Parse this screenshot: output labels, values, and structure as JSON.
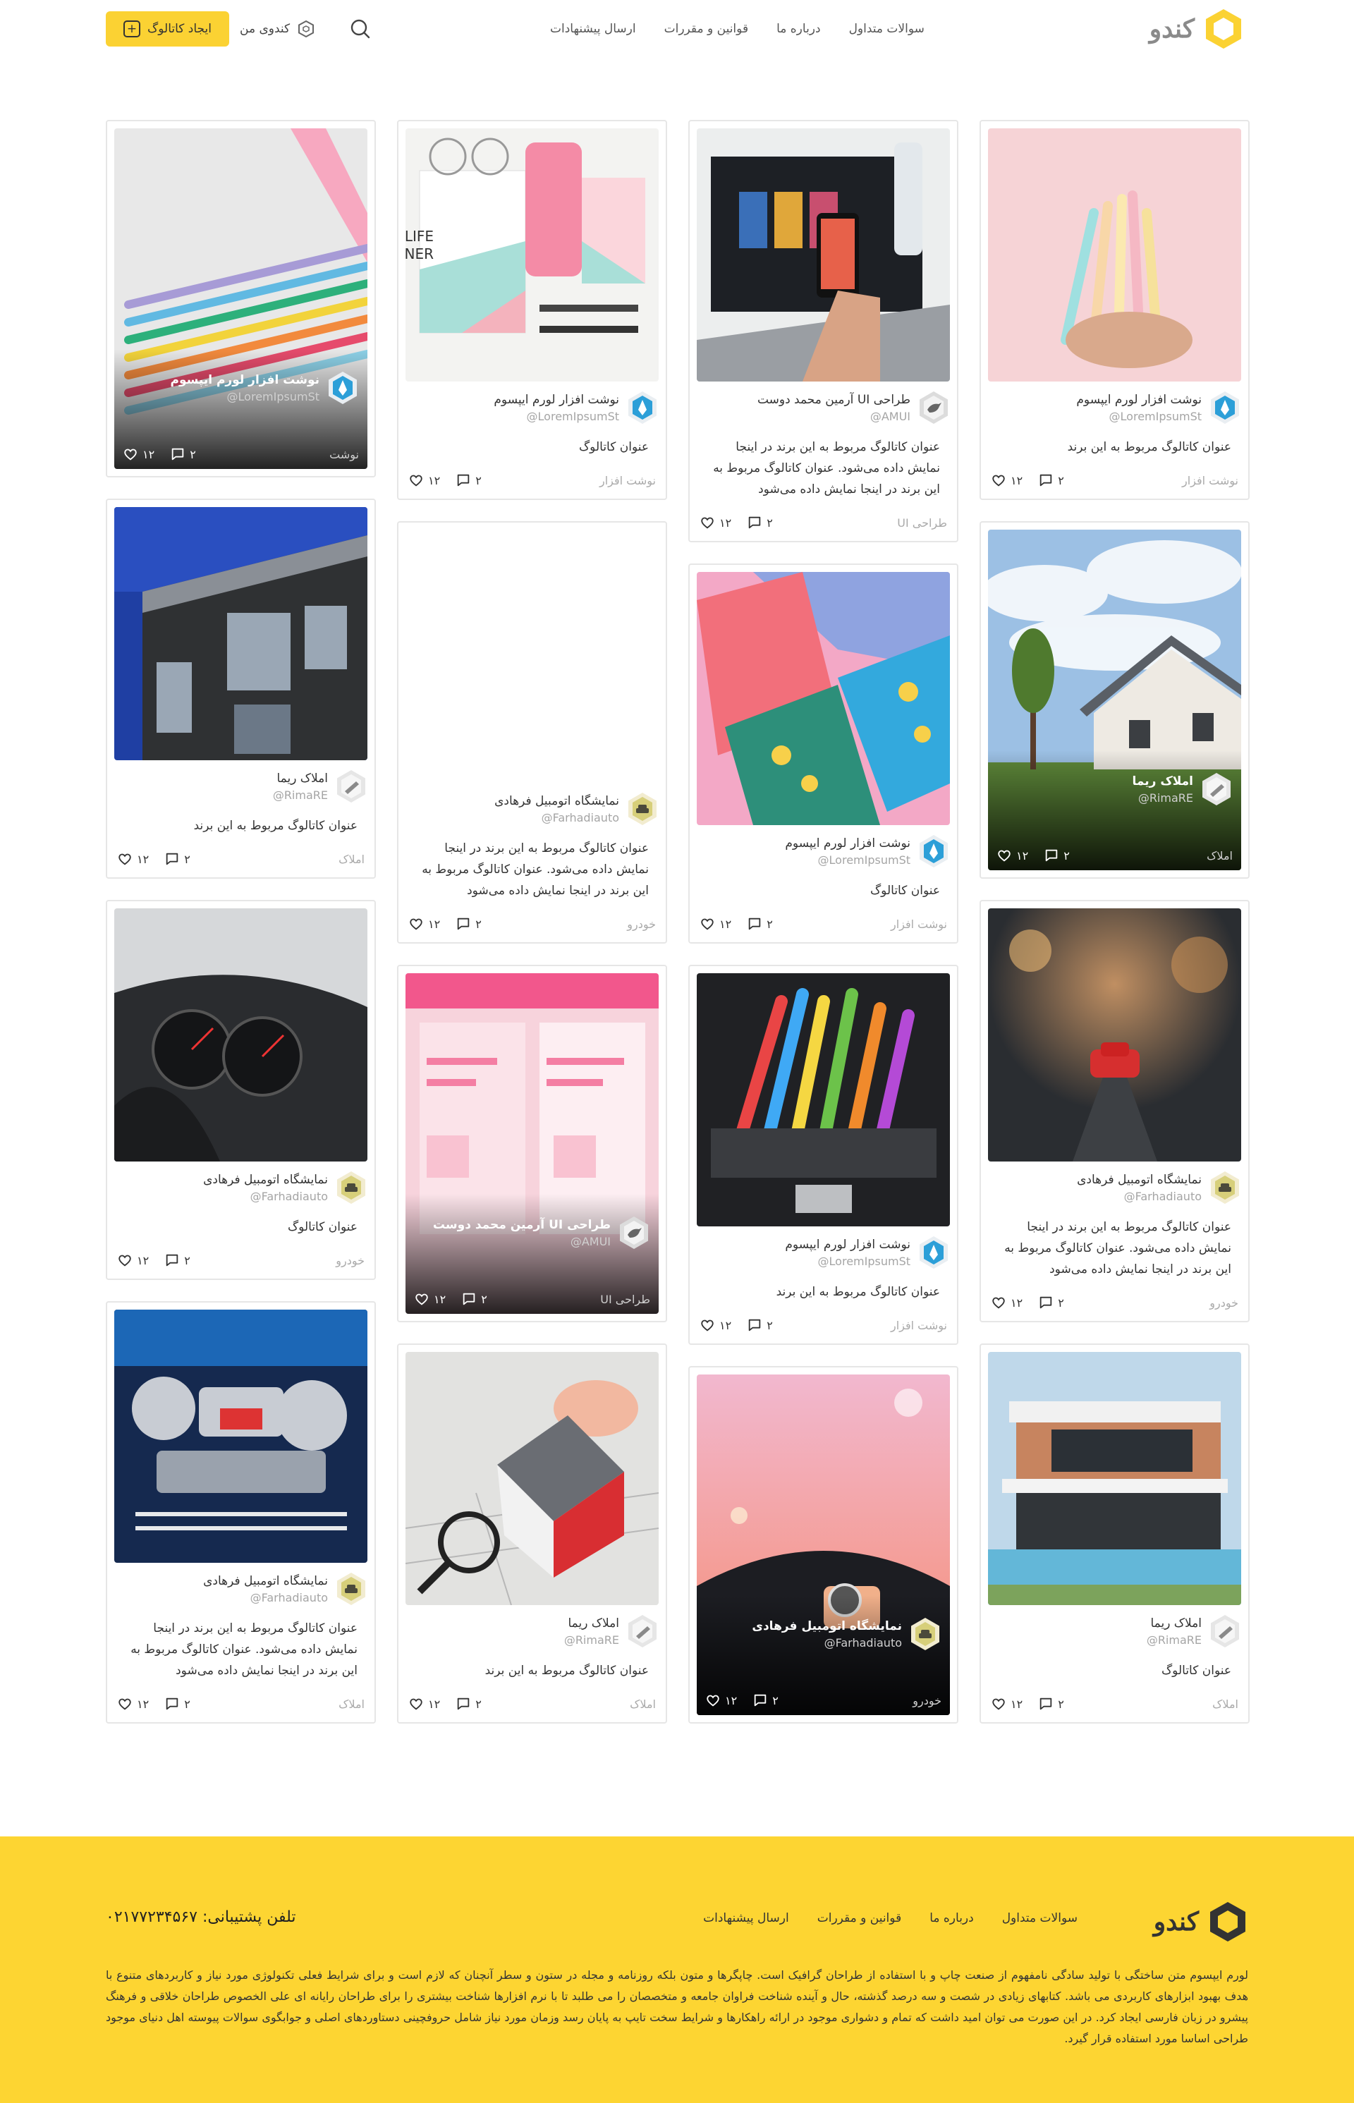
{
  "header": {
    "logo_text": "کندو",
    "nav": [
      "سوالات متداول",
      "درباره ما",
      "قوانین و مقررات",
      "ارسال پیشنهادات"
    ],
    "my_kandoo": "کندوی من",
    "create_catalog": "ایجاد کاتالوگ"
  },
  "columns": [
    [
      {
        "style": "normal",
        "image": "pens",
        "brand": "نوشت افزار لورم ایپسوم",
        "handle": "@LoremIpsumSt",
        "brand_icon": "pen-nib",
        "title": "عنوان کاتالوگ مربوط به این برند",
        "category": "نوشت افزار",
        "likes": "۱۲",
        "comments": "۲"
      },
      {
        "style": "overlay",
        "image": "house",
        "brand": "املاک ریما",
        "handle": "@RimaRE",
        "brand_icon": "building",
        "category": "املاک",
        "likes": "۱۲",
        "comments": "۲"
      },
      {
        "style": "normal",
        "image": "toy-car",
        "brand": "نمایشگاه اتومبیل فرهادی",
        "handle": "@Farhadiauto",
        "brand_icon": "car",
        "title": "عنوان کاتالوگ مربوط به این برند در اینجا نمایش داده می‌شود. عنوان کاتالوگ مربوط به این برند در اینجا نمایش داده می‌شود",
        "category": "خودرو",
        "likes": "۱۲",
        "comments": "۲"
      },
      {
        "style": "normal",
        "image": "modern-house",
        "brand": "املاک ریما",
        "handle": "@RimaRE",
        "brand_icon": "building",
        "title": "عنوان کاتالوگ",
        "category": "املاک",
        "likes": "۱۲",
        "comments": "۲"
      }
    ],
    [
      {
        "style": "normal",
        "image": "laptop",
        "brand": "طراحی UI آرمین محمد دوست",
        "handle": "@AMUI",
        "brand_icon": "bird",
        "title": "عنوان کاتالوگ مربوط به این برند در اینجا نمایش داده می‌شود. عنوان کاتالوگ مربوط به این برند در اینجا نمایش داده می‌شود",
        "category": "طراحی UI",
        "likes": "۱۲",
        "comments": "۲"
      },
      {
        "style": "normal",
        "image": "patterns",
        "brand": "نوشت افزار لورم ایپسوم",
        "handle": "@LoremIpsumSt",
        "brand_icon": "pen-nib",
        "title": "عنوان کاتالوگ",
        "category": "نوشت افزار",
        "likes": "۱۲",
        "comments": "۲"
      },
      {
        "style": "normal",
        "image": "markers",
        "brand": "نوشت افزار لورم ایپسوم",
        "handle": "@LoremIpsumSt",
        "brand_icon": "pen-nib",
        "title": "عنوان کاتالوگ مربوط به این برند",
        "category": "نوشت افزار",
        "likes": "۱۲",
        "comments": "۲"
      },
      {
        "style": "overlay-tall",
        "image": "driving",
        "brand": "نمایشگاه اتومبیل فرهادی",
        "handle": "@Farhadiauto",
        "brand_icon": "car",
        "category": "خودرو",
        "likes": "۱۲",
        "comments": "۲"
      }
    ],
    [
      {
        "style": "normal",
        "image": "planner",
        "brand": "نوشت افزار لورم ایپسوم",
        "handle": "@LoremIpsumSt",
        "brand_icon": "pen-nib",
        "title": "عنوان کاتالوگ",
        "category": "نوشت افزار",
        "likes": "۱۲",
        "comments": "۲"
      },
      {
        "style": "normal",
        "image": "blue-car",
        "brand": "نمایشگاه اتومبیل فرهادی",
        "handle": "@Farhadiauto",
        "brand_icon": "car",
        "title": "عنوان کاتالوگ مربوط به این برند در اینجا نمایش داده می‌شود. عنوان کاتالوگ مربوط به این برند در اینجا نمایش داده می‌شود",
        "category": "خودرو",
        "likes": "۱۲",
        "comments": "۲"
      },
      {
        "style": "overlay-tall",
        "image": "pink-ui",
        "brand": "طراحی UI آرمین محمد دوست",
        "handle": "@AMUI",
        "brand_icon": "bird",
        "category": "طراحی UI",
        "likes": "۱۲",
        "comments": "۲"
      },
      {
        "style": "normal",
        "image": "house-model",
        "brand": "املاک ریما",
        "handle": "@RimaRE",
        "brand_icon": "building",
        "title": "عنوان کاتالوگ مربوط به این برند",
        "category": "املاک",
        "likes": "۱۲",
        "comments": "۲"
      }
    ],
    [
      {
        "style": "overlay-tall",
        "image": "color-pencils",
        "brand": "نوشت افزار لورم ایپسوم",
        "handle": "@LoremIpsumSt",
        "brand_icon": "pen-nib",
        "category": "نوشت",
        "likes": "۱۲",
        "comments": "۲"
      },
      {
        "style": "normal",
        "image": "building-blue",
        "brand": "املاک ریما",
        "handle": "@RimaRE",
        "brand_icon": "building",
        "title": "عنوان کاتالوگ مربوط به این برند",
        "category": "املاک",
        "likes": "۱۲",
        "comments": "۲"
      },
      {
        "style": "normal",
        "image": "dashboard",
        "brand": "نمایشگاه اتومبیل فرهادی",
        "handle": "@Farhadiauto",
        "brand_icon": "car",
        "title": "عنوان کاتالوگ",
        "category": "خودرو",
        "likes": "۱۲",
        "comments": "۲"
      },
      {
        "style": "normal",
        "image": "engine",
        "brand": "نمایشگاه اتومبیل فرهادی",
        "handle": "@Farhadiauto",
        "brand_icon": "car",
        "title": "عنوان کاتالوگ مربوط به این برند در اینجا نمایش داده می‌شود. عنوان کاتالوگ مربوط به این برند در اینجا نمایش داده می‌شود",
        "category": "املاک",
        "likes": "۱۲",
        "comments": "۲"
      }
    ]
  ],
  "footer": {
    "logo_text": "کندو",
    "nav": [
      "سوالات متداول",
      "درباره ما",
      "قوانین و مقررات",
      "ارسال پیشنهادات"
    ],
    "phone": "تلفن پشتیبانی: ۰۲۱۷۷۲۳۴۵۶۷",
    "text": "لورم ایپسوم متن ساختگی با تولید سادگی نامفهوم از صنعت چاپ و با استفاده از طراحان گرافیک است. چاپگرها و متون بلکه روزنامه و مجله در ستون و سطر آنچنان که لازم است و برای شرایط فعلی تکنولوژی مورد نیاز و کاربردهای متنوع با هدف بهبود ابزارهای کاربردی می باشد. کتابهای زیادی در شصت و سه درصد گذشته، حال و آینده شناخت فراوان جامعه و متخصصان را می طلبد تا با نرم افزارها شناخت بیشتری را برای طراحان رایانه ای علی الخصوص طراحان خلاقی و فرهنگ پیشرو در زبان فارسی ایجاد کرد. در این صورت می توان امید داشت که تمام و دشواری موجود در ارائه راهکارها و شرایط سخت تایپ به پایان رسد وزمان مورد نیاز شامل حروفچینی دستاوردهای اصلی و جوابگوی سوالات پیوسته اهل دنیای موجود طراحی اساسا مورد استفاده قرار گیرد."
  },
  "colors": {
    "accent": "#fbd233",
    "footer_bg": "#fdd532",
    "muted": "#aaaaaa"
  }
}
